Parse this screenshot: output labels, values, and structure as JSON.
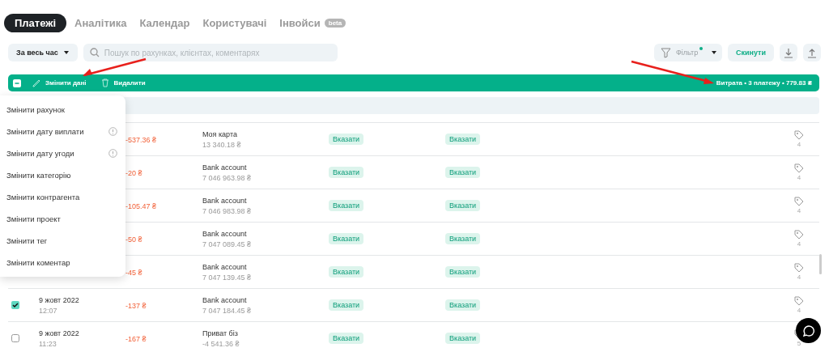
{
  "tabs": [
    {
      "label": "Платежі",
      "selected": true
    },
    {
      "label": "Аналітика",
      "selected": false
    },
    {
      "label": "Календар",
      "selected": false
    },
    {
      "label": "Користувачі",
      "selected": false
    },
    {
      "label": "Інвойси",
      "selected": false,
      "badge": "beta"
    }
  ],
  "toolbar": {
    "period": "За весь час",
    "search": {
      "placeholder": "Пошук по рахунках, клієнтах, коментарях"
    },
    "filter": {
      "label": "Фільтр",
      "active": true
    },
    "reset": "Скинути"
  },
  "bulk_bar": {
    "select_all_partial": true,
    "actions": [
      {
        "label": "Змінити дані",
        "kind": "edit"
      },
      {
        "label": "Видалити",
        "kind": "delete"
      }
    ],
    "summary": "Витрата • 3 платежу • 779.83 ₴"
  },
  "menu": {
    "items": [
      {
        "label": "Змінити рахунок",
        "info": false
      },
      {
        "label": "Змінити дату виплати",
        "info": true
      },
      {
        "label": "Змінити дату угоди",
        "info": true
      },
      {
        "label": "Змінити категорію",
        "info": false
      },
      {
        "label": "Змінити контрагента",
        "info": false
      },
      {
        "label": "Змінити проект",
        "info": false
      },
      {
        "label": "Змінити тег",
        "info": false
      },
      {
        "label": "Змінити коментар",
        "info": false
      }
    ]
  },
  "rows": [
    {
      "amount": "-537.36 ₴",
      "account": "Моя карта",
      "balance": "13 340.18 ₴",
      "category": "Вказати",
      "project": "Вказати",
      "tag_count": "4"
    },
    {
      "amount": "-20 ₴",
      "account": "Bank account",
      "balance": "7 046 963.98 ₴",
      "category": "Вказати",
      "project": "Вказати",
      "tag_count": "4"
    },
    {
      "amount": "-105.47 ₴",
      "account": "Bank account",
      "balance": "7 046 983.98 ₴",
      "category": "Вказати",
      "project": "Вказати",
      "tag_count": "4"
    },
    {
      "amount": "-50 ₴",
      "account": "Bank account",
      "balance": "7 047 089.45 ₴",
      "category": "Вказати",
      "project": "Вказати",
      "tag_count": "4"
    },
    {
      "amount": "-45 ₴",
      "account": "Bank account",
      "balance": "7 047 139.45 ₴",
      "category": "Вказати",
      "project": "Вказати",
      "tag_count": "4"
    },
    {
      "date": "9 жовт 2022",
      "time": "12:07",
      "checked": true,
      "amount": "-137 ₴",
      "account": "Bank account",
      "balance": "7 047 184.45 ₴",
      "category": "Вказати",
      "project": "Вказати",
      "tag_count": "4"
    },
    {
      "date": "9 жовт 2022",
      "time": "11:23",
      "checked": false,
      "amount": "-167 ₴",
      "account": "Приват біз",
      "balance": "-4 541.36 ₴",
      "category": "Вказати",
      "project": "Вказати",
      "tag_count": "5"
    }
  ]
}
